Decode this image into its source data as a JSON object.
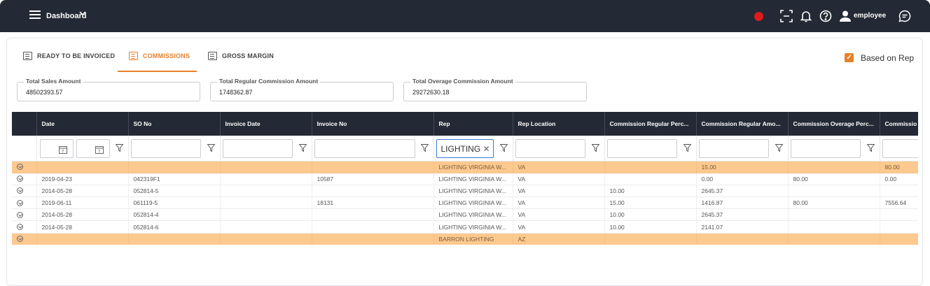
{
  "header": {
    "nav_label": "Dashboard",
    "user_name": "employee"
  },
  "tabs": [
    {
      "label": "READY TO BE INVOICED",
      "active": false
    },
    {
      "label": "COMMISSIONS",
      "active": true
    },
    {
      "label": "GROSS MARGIN",
      "active": false
    }
  ],
  "based_on_rep": {
    "label": "Based on Rep",
    "checked": true
  },
  "summary": [
    {
      "label": "Total Sales Amount",
      "value": "48502393.57"
    },
    {
      "label": "Total Regular Commission Amount",
      "value": "1748362.87"
    },
    {
      "label": "Total Overage Commission Amount",
      "value": "29272630.18"
    }
  ],
  "columns": [
    "Date",
    "SO No",
    "Invoice Date",
    "Invoice No",
    "Rep",
    "Rep Location",
    "Commission Regular Perc...",
    "Commission Regular Amo...",
    "Commission Overage Perc...",
    "Commissio"
  ],
  "filters": {
    "rep_value": "LIGHTING"
  },
  "rows": [
    {
      "group": true,
      "cells": [
        "",
        "",
        "",
        "",
        "LIGHTING VIRGINIA W...",
        "VA",
        "",
        "15.00",
        "",
        "80.00"
      ]
    },
    {
      "group": false,
      "cells": [
        "2019-04-23",
        "042319F1",
        "",
        "10587",
        "LIGHTING VIRGINIA W...",
        "VA",
        "",
        "0.00",
        "80.00",
        "0.00"
      ]
    },
    {
      "group": false,
      "cells": [
        "2014-05-28",
        "052814-5",
        "",
        "",
        "LIGHTING VIRGINIA W...",
        "VA",
        "10.00",
        "2645.37",
        "",
        ""
      ]
    },
    {
      "group": false,
      "cells": [
        "2019-06-11",
        "061119-5",
        "",
        "18131",
        "LIGHTING VIRGINIA W...",
        "VA",
        "15.00",
        "1416.87",
        "80.00",
        "7556.64"
      ]
    },
    {
      "group": false,
      "cells": [
        "2014-05-28",
        "052814-4",
        "",
        "",
        "LIGHTING VIRGINIA W...",
        "VA",
        "10.00",
        "2645.37",
        "",
        ""
      ]
    },
    {
      "group": false,
      "cells": [
        "2014-05-28",
        "052814-6",
        "",
        "",
        "LIGHTING VIRGINIA W...",
        "VA",
        "10.00",
        "2141.07",
        "",
        ""
      ]
    },
    {
      "group": true,
      "cells": [
        "",
        "",
        "",
        "",
        "BARRON LIGHTING",
        "AZ",
        "",
        "",
        "",
        ""
      ]
    }
  ],
  "colors": {
    "accent": "#e8802a",
    "header_bg": "#232a35",
    "group_row": "#fdc98f",
    "record": "#e01b1b"
  },
  "icons": [
    "menu-icon",
    "chevron-down-icon",
    "record-icon",
    "scan-icon",
    "bell-icon",
    "help-icon",
    "user-icon",
    "chat-icon",
    "list-icon",
    "calendar-icon",
    "filter-icon",
    "clear-icon",
    "expand-icon"
  ]
}
